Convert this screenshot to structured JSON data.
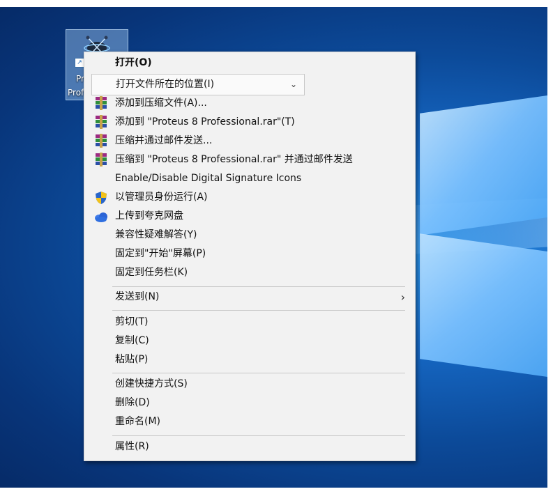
{
  "desktop": {
    "icon_label_line1": "Pro",
    "icon_label_line2": "Prof"
  },
  "menu": {
    "items": [
      {
        "label": "打开(O)",
        "icon": "none"
      },
      {
        "label": "打开文件所在的位置(I)",
        "icon": "none"
      },
      {
        "label": "添加到压缩文件(A)...",
        "icon": "winrar-icon"
      },
      {
        "label": "添加到 \"Proteus 8 Professional.rar\"(T)",
        "icon": "winrar-icon"
      },
      {
        "label": "压缩并通过邮件发送...",
        "icon": "winrar-icon"
      },
      {
        "label": "压缩到 \"Proteus 8 Professional.rar\" 并通过邮件发送",
        "icon": "winrar-icon"
      },
      {
        "label": "Enable/Disable Digital Signature Icons",
        "icon": "none"
      },
      {
        "label": "以管理员身份运行(A)",
        "icon": "uac-shield-icon"
      },
      {
        "label": "上传到夸克网盘",
        "icon": "cloud-icon"
      },
      {
        "label": "兼容性疑难解答(Y)",
        "icon": "none"
      },
      {
        "label": "固定到\"开始\"屏幕(P)",
        "icon": "none"
      },
      {
        "label": "固定到任务栏(K)",
        "icon": "none"
      },
      {
        "label": "发送到(N)",
        "icon": "none"
      },
      {
        "label": "剪切(T)",
        "icon": "none"
      },
      {
        "label": "复制(C)",
        "icon": "none"
      },
      {
        "label": "粘贴(P)",
        "icon": "none"
      },
      {
        "label": "创建快捷方式(S)",
        "icon": "none"
      },
      {
        "label": "删除(D)",
        "icon": "none"
      },
      {
        "label": "重命名(M)",
        "icon": "none"
      },
      {
        "label": "属性(R)",
        "icon": "none"
      }
    ],
    "submenu_arrow": "›",
    "dropdown_chevron": "⌄"
  },
  "colors": {
    "menu_bg": "#f2f2f2",
    "desktop_blue": "#0c4a99",
    "logo_light": "#7cc2ff"
  }
}
